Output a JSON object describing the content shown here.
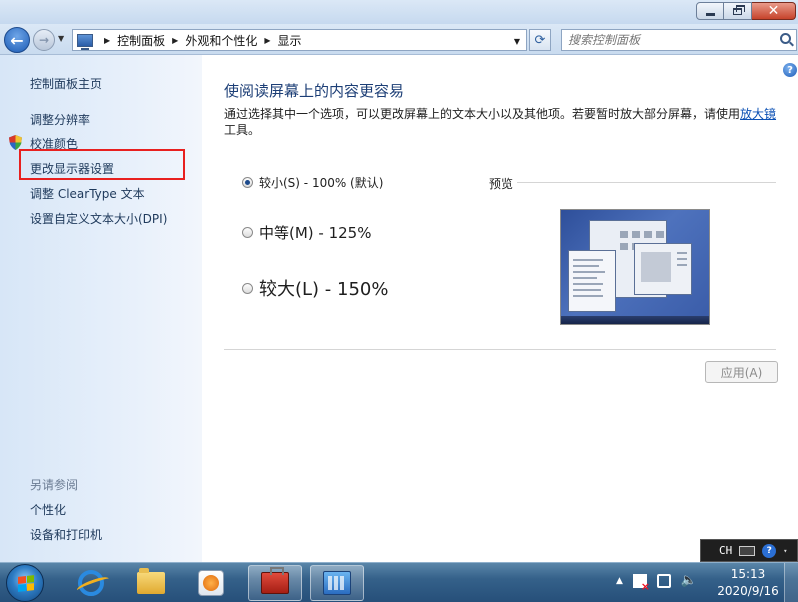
{
  "window": {
    "minimize": "minimize",
    "maximize": "maximize",
    "close": "close"
  },
  "address": {
    "breadcrumbs": [
      "控制面板",
      "外观和个性化",
      "显示"
    ],
    "search_placeholder": "搜索控制面板"
  },
  "sidebar": {
    "home": "控制面板主页",
    "links": [
      "调整分辨率",
      "校准颜色",
      "更改显示器设置",
      "调整 ClearType 文本",
      "设置自定义文本大小(DPI)"
    ],
    "see_also_title": "另请参阅",
    "see_also": [
      "个性化",
      "设备和打印机"
    ]
  },
  "main": {
    "title": "使阅读屏幕上的内容更容易",
    "description_prefix": "通过选择其中一个选项，可以更改屏幕上的文本大小以及其他项。若要暂时放大部分屏幕，请使用",
    "magnifier_link": "放大镜",
    "description_suffix": "工具。",
    "options": [
      {
        "label": "较小(S) - 100% (默认)",
        "selected": true
      },
      {
        "label": "中等(M) - 125%",
        "selected": false
      },
      {
        "label": "较大(L) - 150%",
        "selected": false
      }
    ],
    "preview_label": "预览",
    "apply_button": "应用(A)"
  },
  "langbar": {
    "language": "CH"
  },
  "taskbar": {
    "time": "15:13",
    "date": "2020/9/16"
  },
  "colors": {
    "highlight": "#e8201f",
    "link": "#0b50b4",
    "title": "#1c3e76"
  }
}
